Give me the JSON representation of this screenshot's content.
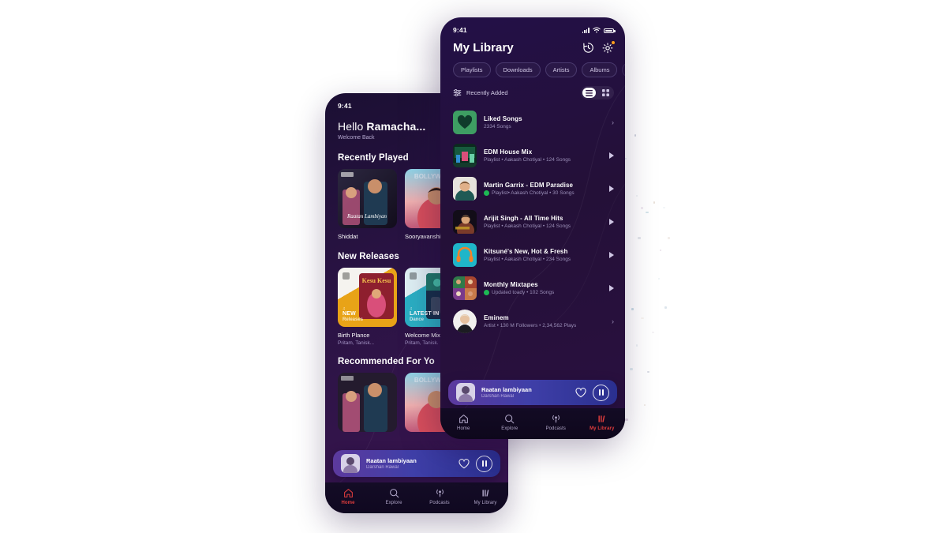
{
  "canvas": {
    "background": "#ffffff"
  },
  "phone_right": {
    "status_bar": {
      "time": "9:41",
      "icons": [
        "signal-icon",
        "wifi-icon",
        "battery-icon"
      ]
    },
    "header": {
      "title": "My Library",
      "actions": [
        {
          "name": "history-icon",
          "label": "History"
        },
        {
          "name": "settings-gear-icon",
          "label": "Settings",
          "badge": true,
          "badge_color": "#FF9D1E"
        }
      ]
    },
    "filter_chips": [
      {
        "label": "Playlists",
        "selected": false
      },
      {
        "label": "Downloads",
        "selected": false
      },
      {
        "label": "Artists",
        "selected": false
      },
      {
        "label": "Albums",
        "selected": false
      },
      {
        "label": "",
        "selected": false,
        "cut_off": true
      }
    ],
    "sort_row": {
      "icon": "sort-sliders-icon",
      "label": "Recently Added",
      "view_list_icon": "list-view-icon",
      "view_grid_icon": "grid-view-icon",
      "active_view": "list"
    },
    "items": [
      {
        "title": "Liked Songs",
        "subtitle": "2334 Songs",
        "thumb": "liked-heart",
        "trailing": "chevron",
        "spotify_dot": false
      },
      {
        "title": "EDM House Mix",
        "subtitle": "Playlist • Aakash Chotiyal • 124 Songs",
        "thumb": "edm-house",
        "trailing": "play",
        "spotify_dot": false
      },
      {
        "title": "Martin Garrix - EDM Paradise",
        "subtitle": "Playlist• Aakash Chotiyal • 30 Songs",
        "thumb": "garrix",
        "trailing": "play",
        "spotify_dot": true
      },
      {
        "title": "Arijit Singh - All Time Hits",
        "subtitle": "Playlist • Aakash Chotiyal • 124 Songs",
        "thumb": "arijit",
        "trailing": "play",
        "spotify_dot": false
      },
      {
        "title": "Kitsuné's New, Hot & Fresh",
        "subtitle": "Playlist • Aakash Chotiyal • 234 Songs",
        "thumb": "kitsune",
        "trailing": "play",
        "spotify_dot": false
      },
      {
        "title": "Monthly Mixtapes",
        "subtitle": "Updated toady • 102 Songs",
        "thumb": "mixtapes",
        "trailing": "play",
        "spotify_dot": true
      },
      {
        "title": "Eminem",
        "subtitle": "Artist • 130 M Followers • 2,34,562 Plays",
        "thumb": "eminem",
        "trailing": "chevron",
        "spotify_dot": false
      }
    ],
    "now_playing": {
      "title": "Raatan lambiyaan",
      "artist": "Darshan Rawal",
      "like_icon": "heart-outline-icon",
      "pause_icon": "pause-icon"
    },
    "bottom_nav": [
      {
        "label": "Home",
        "icon": "home-icon",
        "active": false
      },
      {
        "label": "Explore",
        "icon": "search-icon",
        "active": false
      },
      {
        "label": "Podcasts",
        "icon": "podcast-icon",
        "active": false
      },
      {
        "label": "My Library",
        "icon": "library-icon",
        "active": true
      }
    ],
    "accent_color": "#E23D3D"
  },
  "phone_left": {
    "status_bar": {
      "time": "9:41"
    },
    "greeting": {
      "hello": "Hello ",
      "name": "Ramacha...",
      "welcome": "Welcome Back"
    },
    "sections": [
      {
        "title": "Recently Played",
        "cards": [
          {
            "title": "Shiddat",
            "subtitle": "",
            "art": "shiddat"
          },
          {
            "title": "Sooryavanshi",
            "subtitle": "",
            "art": "sooryavanshi"
          }
        ]
      },
      {
        "title": "New Releases",
        "cards": [
          {
            "title": "Birth Plance",
            "subtitle": "Pritam, Tanisk...",
            "art": "new-releases",
            "cap1": "NEW",
            "cap2": "Releases",
            "tint": "#E8A317"
          },
          {
            "title": "Welcome Mix",
            "subtitle": "Pritam, Tanisk.",
            "art": "latest-in-dance",
            "cap1": "LATEST IN",
            "cap2": "Dance",
            "tint": "#2BAFC4"
          }
        ]
      },
      {
        "title": "Recommended For Yo",
        "cards": []
      }
    ],
    "now_playing": {
      "title": "Raatan lambiyaan",
      "artist": "Darshan Rawal",
      "like_icon": "heart-outline-icon",
      "pause_icon": "pause-icon"
    },
    "bottom_nav": [
      {
        "label": "Home",
        "icon": "home-icon",
        "active": true
      },
      {
        "label": "Explore",
        "icon": "search-icon",
        "active": false
      },
      {
        "label": "Podcasts",
        "icon": "podcast-icon",
        "active": false
      },
      {
        "label": "My Library",
        "icon": "library-icon",
        "active": false
      }
    ],
    "accent_color": "#E23D3D"
  }
}
